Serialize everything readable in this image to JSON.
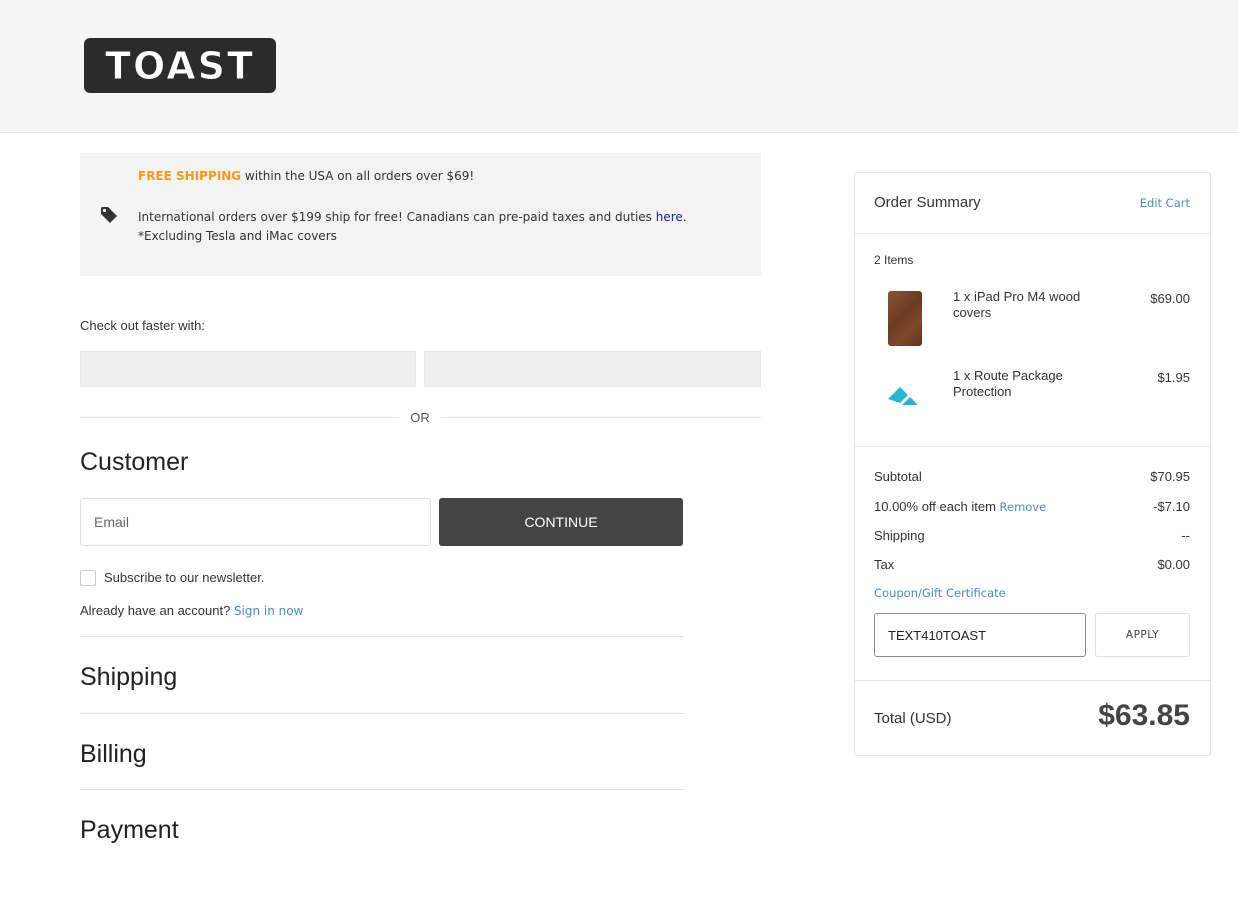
{
  "header": {
    "logo_text": "TOAST"
  },
  "promo": {
    "free_shipping": "FREE SHIPPING",
    "line1_rest": " within the USA on all orders over $69!",
    "line2": "International orders over $199 ship for free! Canadians can pre-paid taxes and duties ",
    "here_link": "here.",
    "line2_tail": "  *Excluding Tesla and iMac covers",
    "tag_icon": "tag-icon"
  },
  "express": {
    "label": "Check out faster with:",
    "or": "OR"
  },
  "customer": {
    "title": "Customer",
    "email_placeholder": "Email",
    "continue_label": "CONTINUE",
    "newsletter_label": "Subscribe to our newsletter.",
    "account_text": "Already have an account? ",
    "signin_link": "Sign in now"
  },
  "sections": {
    "shipping": "Shipping",
    "billing": "Billing",
    "payment": "Payment"
  },
  "summary": {
    "title": "Order Summary",
    "edit_cart": "Edit Cart",
    "items_count": "2 Items",
    "items": [
      {
        "name": "1 x iPad Pro M4 wood covers",
        "price": "$69.00"
      },
      {
        "name": "1 x Route Package Protection",
        "price": "$1.95"
      }
    ],
    "subtotal_label": "Subtotal",
    "subtotal_value": "$70.95",
    "discount_label": "10.00% off each item ",
    "discount_remove": "Remove",
    "discount_value": "-$7.10",
    "shipping_label": "Shipping",
    "shipping_value": "--",
    "tax_label": "Tax",
    "tax_value": "$0.00",
    "coupon_link": "Coupon/Gift Certificate",
    "coupon_value": "TEXT410TOAST",
    "apply_label": "APPLY",
    "total_label": "Total (USD)",
    "total_value": "$63.85"
  },
  "colors": {
    "accent_link": "#4a8cc7",
    "free_shipping": "#f59a1b",
    "continue_bg": "#444444",
    "route_icon": "#29b6d6"
  }
}
